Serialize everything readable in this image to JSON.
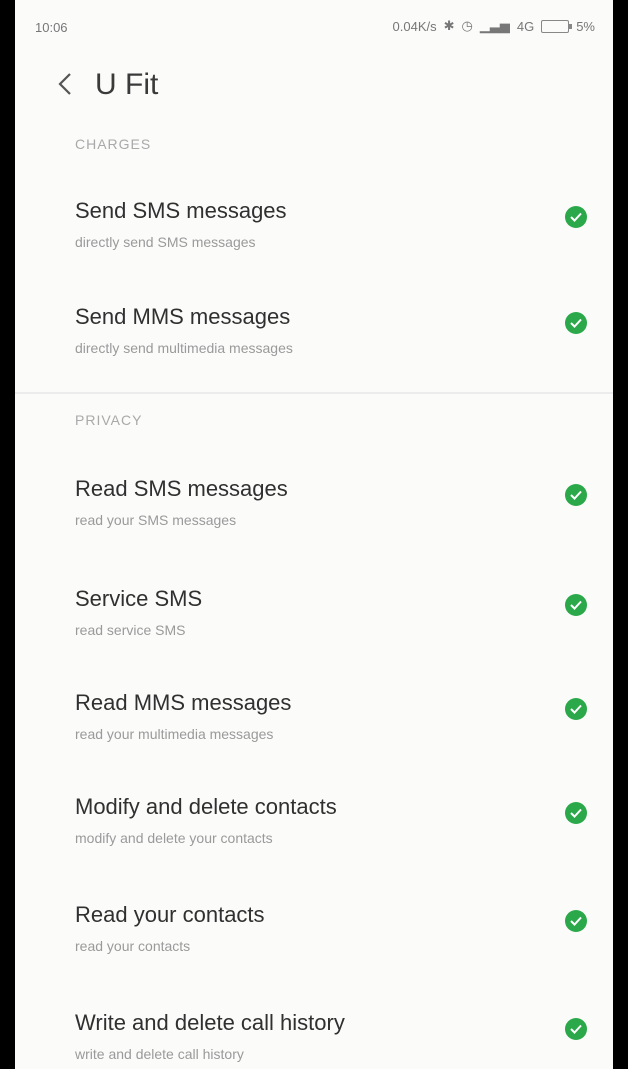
{
  "status_bar": {
    "time": "10:06",
    "net_speed": "0.04K/s",
    "network": "4G",
    "battery": "5%"
  },
  "app_bar": {
    "title": "U Fit"
  },
  "sections": [
    {
      "header": "CHARGES",
      "items": [
        {
          "title": "Send SMS messages",
          "subtitle": "directly send SMS messages"
        },
        {
          "title": "Send MMS messages",
          "subtitle": "directly send multimedia messages"
        }
      ]
    },
    {
      "header": "PRIVACY",
      "items": [
        {
          "title": "Read SMS messages",
          "subtitle": "read your SMS messages"
        },
        {
          "title": "Service SMS",
          "subtitle": "read service SMS"
        },
        {
          "title": "Read MMS messages",
          "subtitle": "read your multimedia messages"
        },
        {
          "title": "Modify and delete contacts",
          "subtitle": "modify and delete your contacts"
        },
        {
          "title": "Read your contacts",
          "subtitle": "read your contacts"
        },
        {
          "title": "Write and delete call history",
          "subtitle": "write and delete call history"
        }
      ]
    }
  ],
  "icons": {
    "back": "chevron-left-icon",
    "allowed": "check-circle-icon"
  },
  "colors": {
    "allowed_green": "#2ba84a",
    "background": "#fbfbfa"
  }
}
